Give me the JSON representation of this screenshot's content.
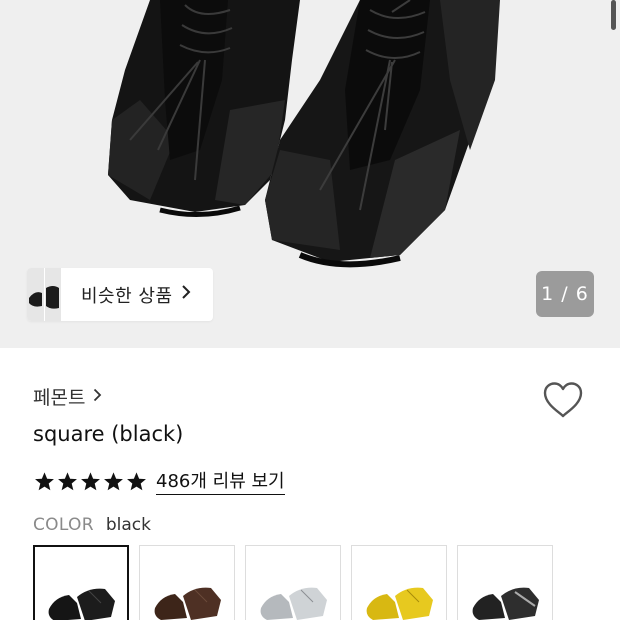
{
  "gallery": {
    "similar_label": "비슷한 상품",
    "similar_chevron": "chevron-right-icon",
    "counter": "1 / 6"
  },
  "product": {
    "brand": "페몬트",
    "brand_chevron": "chevron-right-icon",
    "title": "square (black)",
    "rating": 5,
    "review_link": "486개 리뷰 보기",
    "wishlist_icon": "heart-outline-icon"
  },
  "color": {
    "label": "COLOR",
    "value": "black",
    "options": [
      {
        "name": "black",
        "hex": "#1a1a1a",
        "selected": true
      },
      {
        "name": "brown",
        "hex": "#4a2e22",
        "selected": false
      },
      {
        "name": "silver",
        "hex": "#bfc3c7",
        "selected": false
      },
      {
        "name": "yellow",
        "hex": "#e0c21a",
        "selected": false
      },
      {
        "name": "black-grey",
        "hex": "#2b2b2b",
        "selected": false
      }
    ]
  }
}
